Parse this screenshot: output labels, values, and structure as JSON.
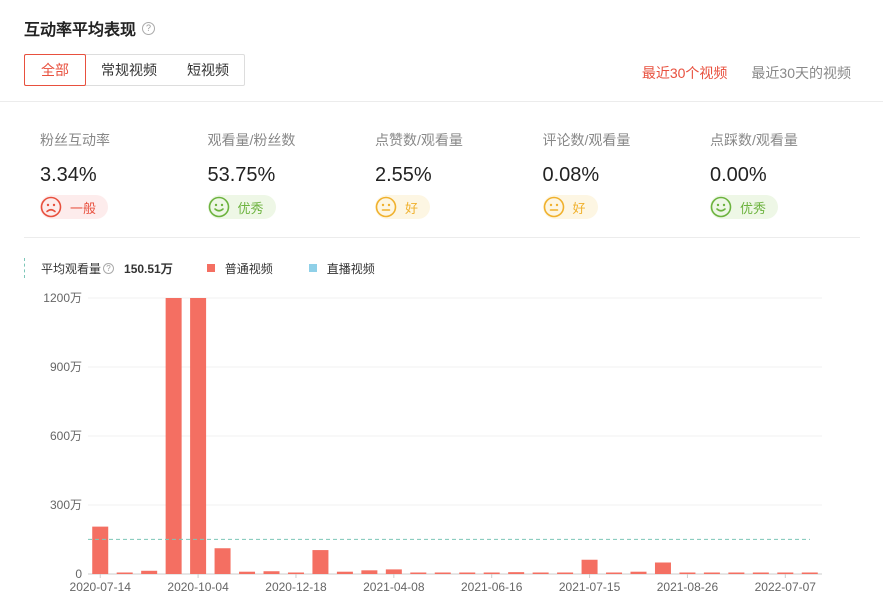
{
  "header": {
    "title": "互动率平均表现",
    "help_icon": "question-circle-icon"
  },
  "tabs": [
    {
      "label": "全部",
      "active": true
    },
    {
      "label": "常规视频",
      "active": false
    },
    {
      "label": "短视频",
      "active": false
    }
  ],
  "range": [
    {
      "label": "最近30个视频",
      "active": true
    },
    {
      "label": "最近30天的视频",
      "active": false
    }
  ],
  "metrics": [
    {
      "label": "粉丝互动率",
      "value": "3.34%",
      "rating": "一般",
      "rating_type": "bad",
      "icon": "sad-face-icon"
    },
    {
      "label": "观看量/粉丝数",
      "value": "53.75%",
      "rating": "优秀",
      "rating_type": "excellent",
      "icon": "smile-face-icon"
    },
    {
      "label": "点赞数/观看量",
      "value": "2.55%",
      "rating": "好",
      "rating_type": "good",
      "icon": "neutral-face-icon"
    },
    {
      "label": "评论数/观看量",
      "value": "0.08%",
      "rating": "好",
      "rating_type": "good",
      "icon": "neutral-face-icon"
    },
    {
      "label": "点踩数/观看量",
      "value": "0.00%",
      "rating": "优秀",
      "rating_type": "excellent",
      "icon": "smile-face-icon"
    }
  ],
  "legend": {
    "avg_label": "平均观看量",
    "avg_value": "150.51万",
    "series": [
      {
        "name": "普通视频",
        "color": "#f46f62"
      },
      {
        "name": "直播视频",
        "color": "#8fd0e8"
      }
    ]
  },
  "colors": {
    "accent": "#e8503e",
    "bar": "#f46f62",
    "avg_line": "#7cc6b8"
  },
  "chart_data": {
    "type": "bar",
    "ylim": [
      0,
      1200
    ],
    "yticks": [
      0,
      300,
      600,
      900,
      1200
    ],
    "ytick_labels": [
      "0",
      "300万",
      "600万",
      "900万",
      "1200万"
    ],
    "grid": true,
    "average": 150.51,
    "series": [
      {
        "name": "普通视频",
        "values": [
          206,
          3,
          14,
          1200,
          1200,
          112,
          10,
          12,
          4,
          104,
          10,
          16,
          20,
          3,
          2,
          2,
          2,
          8,
          2,
          3,
          62,
          6,
          10,
          50,
          2,
          3,
          4,
          6,
          3,
          2
        ]
      }
    ],
    "x_tick_labels": [
      {
        "index": 0,
        "label": "2020-07-14"
      },
      {
        "index": 4,
        "label": "2020-10-04"
      },
      {
        "index": 8,
        "label": "2020-12-18"
      },
      {
        "index": 12,
        "label": "2021-04-08"
      },
      {
        "index": 16,
        "label": "2021-06-16"
      },
      {
        "index": 20,
        "label": "2021-07-15"
      },
      {
        "index": 24,
        "label": "2021-08-26"
      },
      {
        "index": 28,
        "label": "2022-07-07"
      }
    ]
  }
}
